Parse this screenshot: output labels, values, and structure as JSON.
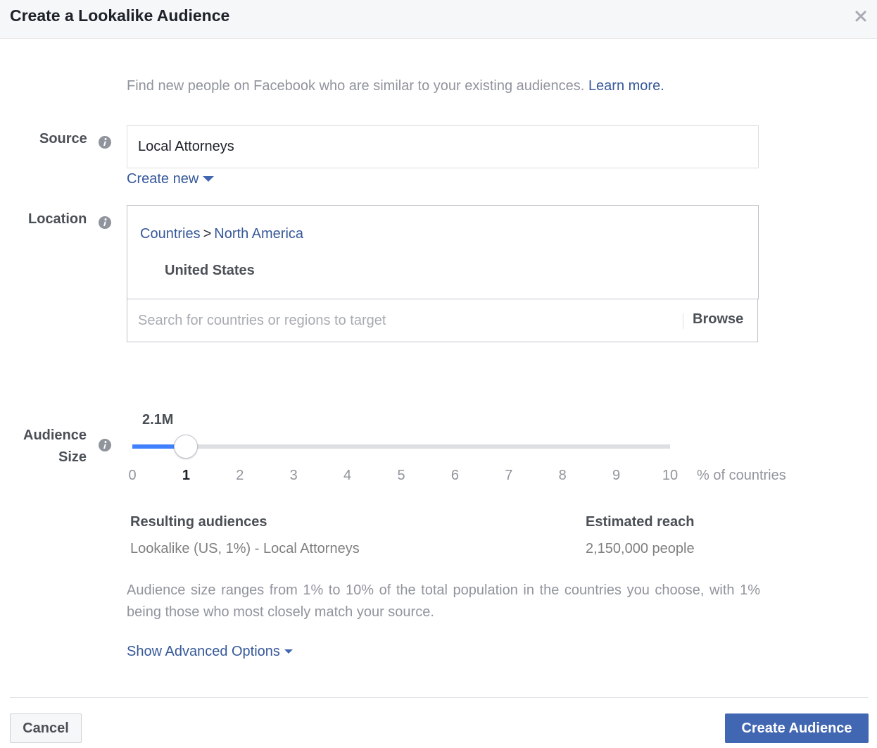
{
  "header": {
    "title": "Create a Lookalike Audience",
    "close_icon": "close-icon"
  },
  "intro": {
    "text": "Find new people on Facebook who are similar to your existing audiences.",
    "learn_more": "Learn more."
  },
  "source": {
    "label": "Source",
    "info_icon": "info-icon",
    "value": "Local Attorneys",
    "create_new": "Create new"
  },
  "location": {
    "label": "Location",
    "info_icon": "info-icon",
    "breadcrumb": [
      "Countries",
      "North America"
    ],
    "breadcrumb_sep": ">",
    "selected": [
      "United States"
    ],
    "search_placeholder": "Search for countries or regions to target",
    "search_value": "",
    "browse": "Browse"
  },
  "audience_size": {
    "label_line1": "Audience",
    "label_line2": "Size",
    "info_icon": "info-icon",
    "size_display": "2.1M",
    "slider_min": 0,
    "slider_max": 10,
    "slider_value": 1,
    "ticks": [
      "0",
      "1",
      "2",
      "3",
      "4",
      "5",
      "6",
      "7",
      "8",
      "9",
      "10"
    ],
    "active_tick": "1",
    "unit": "% of countries"
  },
  "results": {
    "audiences_header": "Resulting audiences",
    "audiences_value": "Lookalike (US, 1%) - Local Attorneys",
    "reach_header": "Estimated reach",
    "reach_value": "2,150,000 people"
  },
  "help_text": "Audience size ranges from 1% to 10% of the total population in the countries you choose, with 1% being those who most closely match your source.",
  "advanced_options": "Show Advanced Options",
  "footer": {
    "cancel": "Cancel",
    "create": "Create Audience"
  },
  "colors": {
    "link": "#365899",
    "primary_button": "#4267b2",
    "slider_fill": "#4080ff",
    "slider_track": "#dddfe2",
    "header_bg": "#f6f7f9"
  }
}
